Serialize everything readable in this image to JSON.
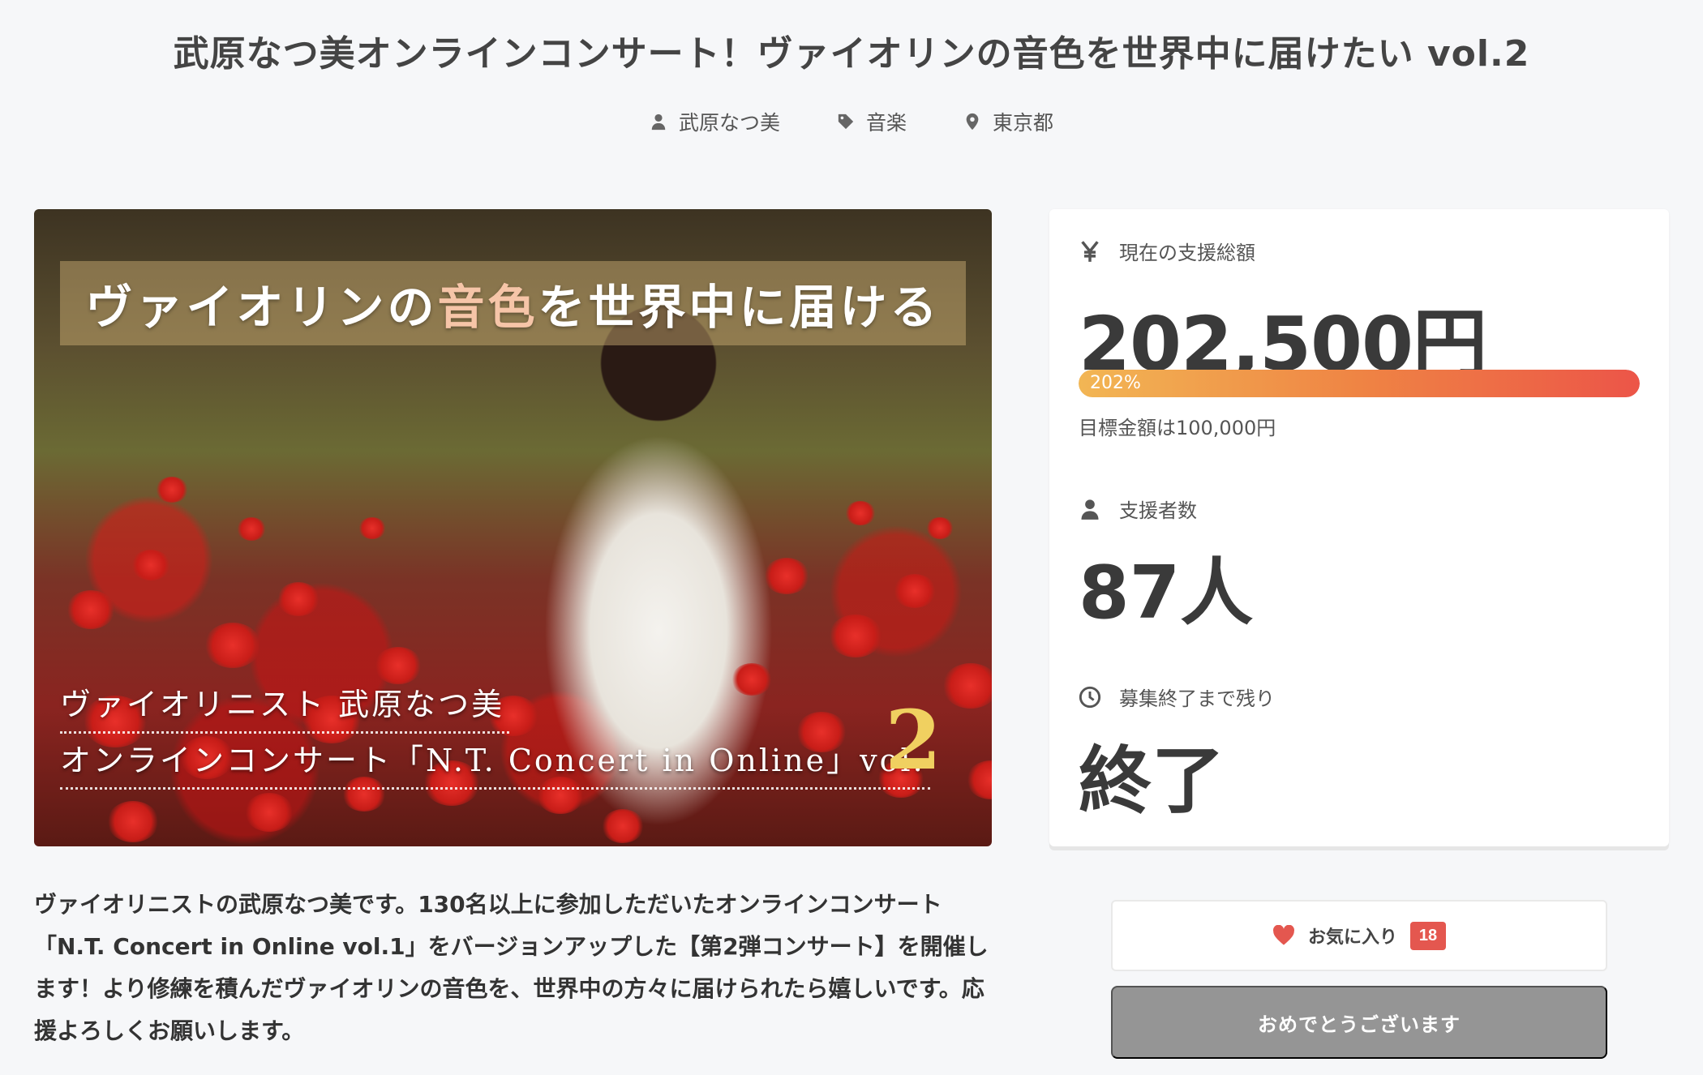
{
  "project": {
    "title": "武原なつ美オンラインコンサート！ヴァイオリンの音色を世界中に届けたい vol.2",
    "author": "武原なつ美",
    "category": "音楽",
    "location": "東京都"
  },
  "hero": {
    "banner_pre": "ヴァイオリンの",
    "banner_accent": "音色",
    "banner_post": "を世界中に届ける",
    "caption_line1": "ヴァイオリニスト 武原なつ美",
    "caption_line2": "オンラインコンサート「N.T. Concert in Online」vol.",
    "caption_number": "2"
  },
  "summary": "ヴァイオリニストの武原なつ美です。130名以上に参加しただいたオンラインコンサート「N.T. Concert in Online vol.1」をバージョンアップした【第2弾コンサート】を開催します！より修練を積んだヴァイオリンの音色を、世界中の方々に届けられたら嬉しいです。応援よろしくお願いします。",
  "stats": {
    "funding_label": "現在の支援総額",
    "funding_amount": "202,500円",
    "progress_percent": 202,
    "progress_label": "202%",
    "goal_text": "目標金額は100,000円",
    "backers_label": "支援者数",
    "backers_value": "87人",
    "remaining_label": "募集終了まで残り",
    "remaining_value": "終了"
  },
  "actions": {
    "favorite_label": "お気に入り",
    "favorite_count": "18",
    "status_button_label": "おめでとうございます"
  },
  "colors": {
    "accent_red": "#e4574f",
    "progress_start": "#f2b654",
    "progress_end": "#ec5548",
    "disabled_button": "#959595"
  },
  "icons": {
    "author": "user-icon",
    "category": "tag-icon",
    "location": "map-pin-icon",
    "funding": "yen-icon",
    "backers": "user-icon",
    "remaining": "clock-icon",
    "favorite": "heart-icon"
  }
}
